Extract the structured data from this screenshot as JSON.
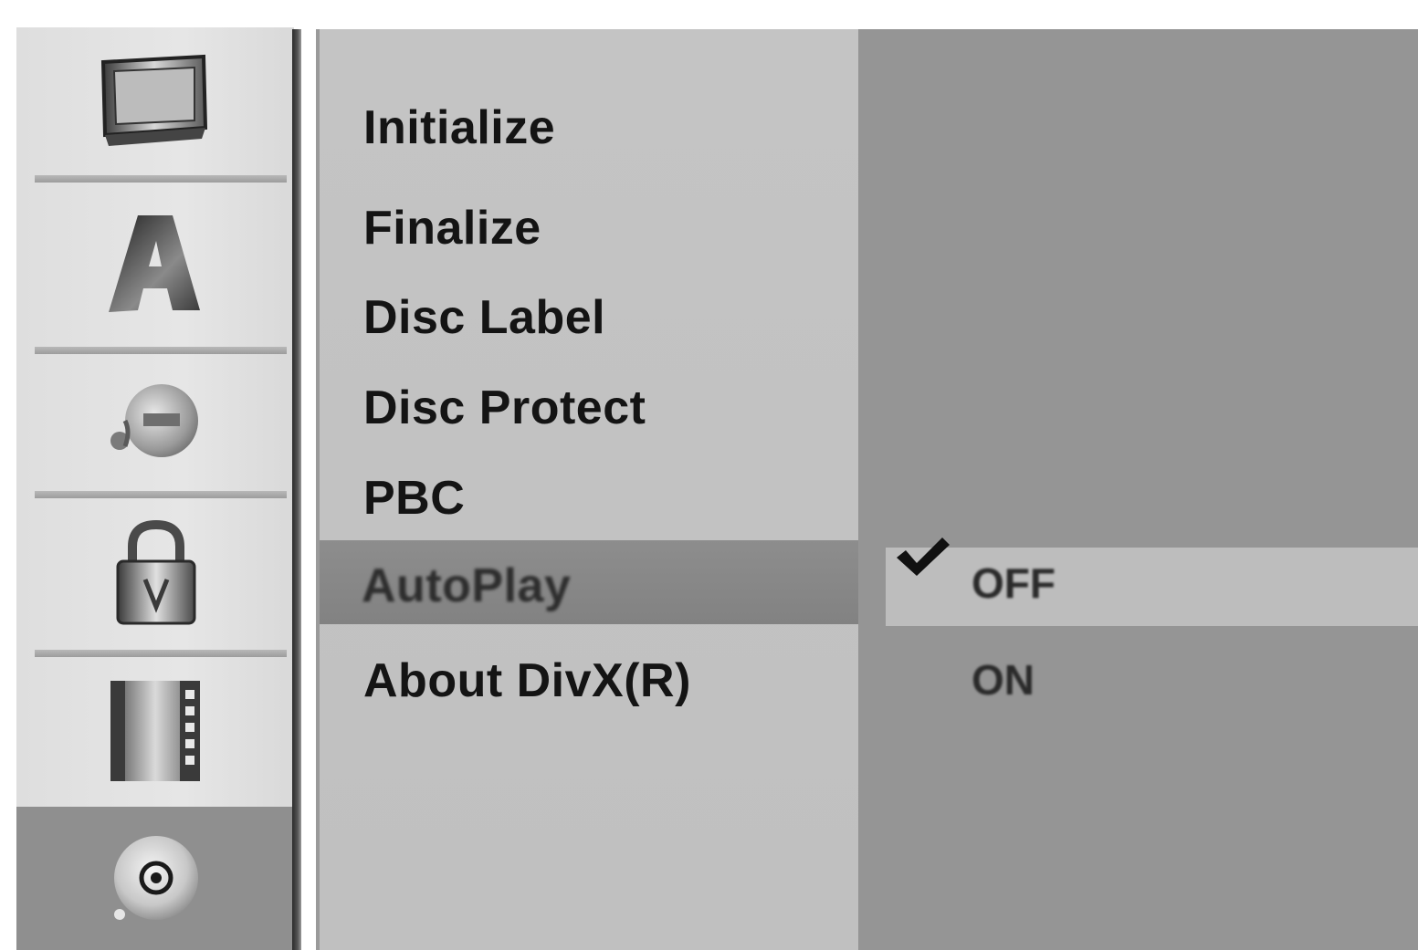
{
  "menu": {
    "items": [
      {
        "label": "Initialize"
      },
      {
        "label": "Finalize"
      },
      {
        "label": "Disc Label"
      },
      {
        "label": "Disc Protect"
      },
      {
        "label": "PBC"
      },
      {
        "label": "AutoPlay"
      },
      {
        "label": "About DivX(R)"
      }
    ],
    "selected_index": 5
  },
  "options": {
    "items": [
      {
        "label": "OFF",
        "checked": true
      },
      {
        "label": "ON",
        "checked": false
      }
    ]
  },
  "sidebar": {
    "icons": [
      {
        "name": "tv-icon"
      },
      {
        "name": "language-a-icon"
      },
      {
        "name": "audio-icon"
      },
      {
        "name": "lock-icon"
      },
      {
        "name": "film-icon"
      },
      {
        "name": "disc-icon",
        "selected": true
      }
    ]
  }
}
